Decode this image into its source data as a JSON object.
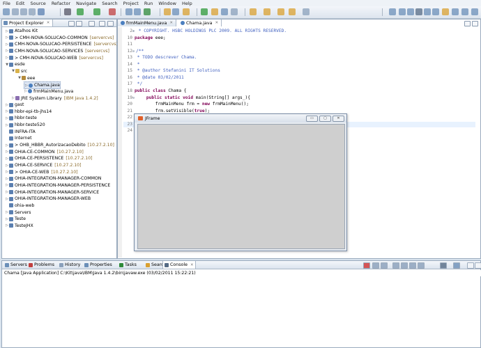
{
  "menu": [
    "File",
    "Edit",
    "Source",
    "Refactor",
    "Navigate",
    "Search",
    "Project",
    "Run",
    "Window",
    "Help"
  ],
  "explorer": {
    "title": "Project Explorer",
    "items": [
      {
        "label": "Atalhos Kit",
        "icon": "project",
        "indent": 0,
        "twisty": "closed"
      },
      {
        "label": "> CMH-NOVA-SOLUCAO-COMMON",
        "deco": "[servercvs]",
        "icon": "project",
        "indent": 0,
        "twisty": "closed"
      },
      {
        "label": "CMH-NOVA-SOLUCAO-PERSISTENCE",
        "deco": "[servercvs]",
        "icon": "project",
        "indent": 0,
        "twisty": "closed"
      },
      {
        "label": "CMH-NOVA-SOLUCAO-SERVICES",
        "deco": "[servercvs]",
        "icon": "project",
        "indent": 0,
        "twisty": "closed"
      },
      {
        "label": "> CMH-NOVA-SOLUCAO-WEB",
        "deco": "[servercvs]",
        "icon": "project",
        "indent": 0,
        "twisty": "closed"
      },
      {
        "label": "esde",
        "icon": "project",
        "indent": 0,
        "twisty": "open"
      },
      {
        "label": "src",
        "icon": "folder",
        "indent": 1,
        "twisty": "open"
      },
      {
        "label": "eee",
        "icon": "package",
        "indent": 2,
        "twisty": "open"
      },
      {
        "label": "Chama.java",
        "icon": "java",
        "indent": 3,
        "twisty": "closed",
        "selected": true
      },
      {
        "label": "frmMainMenu.java",
        "icon": "java",
        "indent": 3,
        "twisty": "closed"
      },
      {
        "label": "JRE System Library",
        "deco": "[IBM Java 1.4.2]",
        "icon": "lib",
        "indent": 1,
        "twisty": "closed"
      },
      {
        "label": "gast",
        "icon": "project",
        "indent": 0,
        "twisty": "closed"
      },
      {
        "label": "hbbr-epi-tb-jhs14",
        "icon": "project",
        "indent": 0,
        "twisty": "closed"
      },
      {
        "label": "hbbr-teste",
        "icon": "project",
        "indent": 0,
        "twisty": "closed"
      },
      {
        "label": "hbbr-teste520",
        "icon": "project",
        "indent": 0,
        "twisty": "closed"
      },
      {
        "label": "INFRA-ITA",
        "icon": "project",
        "indent": 0,
        "twisty": "none"
      },
      {
        "label": "Internet",
        "icon": "project",
        "indent": 0,
        "twisty": "none"
      },
      {
        "label": "> OHB_HBBR_AutorizacaoDebito",
        "deco": "[10.27.2.10]",
        "icon": "project",
        "indent": 0,
        "twisty": "closed"
      },
      {
        "label": "OHIA-CE-COMMON",
        "deco": "[10.27.2.10]",
        "icon": "project",
        "indent": 0,
        "twisty": "closed"
      },
      {
        "label": "OHIA-CE-PERSISTENCE",
        "deco": "[10.27.2.10]",
        "icon": "project",
        "indent": 0,
        "twisty": "closed"
      },
      {
        "label": "OHIA-CE-SERVICE",
        "deco": "[10.27.2.10]",
        "icon": "project",
        "indent": 0,
        "twisty": "closed"
      },
      {
        "label": "> OHIA-CE-WEB",
        "deco": "[10.27.2.10]",
        "icon": "project",
        "indent": 0,
        "twisty": "closed"
      },
      {
        "label": "OHIA-INTEGRATION-MANAGER-COMMON",
        "icon": "project",
        "indent": 0,
        "twisty": "closed"
      },
      {
        "label": "OHIA-INTEGRATION-MANAGER-PERSISTENCE",
        "icon": "project",
        "indent": 0,
        "twisty": "closed"
      },
      {
        "label": "OHIA-INTEGRATION-MANAGER-SERVICE",
        "icon": "project",
        "indent": 0,
        "twisty": "closed"
      },
      {
        "label": "OHIA-INTEGRATION-MANAGER-WEB",
        "icon": "project",
        "indent": 0,
        "twisty": "closed"
      },
      {
        "label": "ohia-web",
        "icon": "project",
        "indent": 0,
        "twisty": "none"
      },
      {
        "label": "Servers",
        "icon": "project",
        "indent": 0,
        "twisty": "closed"
      },
      {
        "label": "Teste",
        "icon": "project",
        "indent": 0,
        "twisty": "closed"
      },
      {
        "label": "TesteJHX",
        "icon": "project",
        "indent": 0,
        "twisty": "closed"
      }
    ]
  },
  "editor": {
    "tabs": [
      {
        "label": "frmMainMenu.java",
        "active": false
      },
      {
        "label": "Chama.java",
        "active": true
      }
    ],
    "lines": [
      {
        "num": "2",
        "fold": "⊕",
        "parts": [
          {
            "t": " * COPYRIGHT. HSBC HOLDINGS PLC 2009. ALL RIGHTS RESERVED.",
            "c": "cm"
          }
        ]
      },
      {
        "num": "10",
        "parts": [
          {
            "t": "package",
            "c": "kw"
          },
          {
            "t": " eee;"
          }
        ]
      },
      {
        "num": "11",
        "parts": []
      },
      {
        "num": "12",
        "fold": "⊖",
        "parts": [
          {
            "t": "/**",
            "c": "cm"
          }
        ]
      },
      {
        "num": "13",
        "parts": [
          {
            "t": " * TODO descrever Chama.",
            "c": "cm"
          }
        ]
      },
      {
        "num": "14",
        "parts": [
          {
            "t": " *",
            "c": "cm"
          }
        ]
      },
      {
        "num": "15",
        "parts": [
          {
            "t": " * @author Stefanini IT Solutions",
            "c": "cm"
          }
        ]
      },
      {
        "num": "16",
        "parts": [
          {
            "t": " * @date 03/02/2011",
            "c": "cm"
          }
        ]
      },
      {
        "num": "17",
        "parts": [
          {
            "t": " */",
            "c": "cm"
          }
        ]
      },
      {
        "num": "18",
        "parts": [
          {
            "t": "public class",
            "c": "kw"
          },
          {
            "t": " Chama {"
          }
        ]
      },
      {
        "num": "19",
        "fold": "⊖",
        "parts": [
          {
            "t": "    "
          },
          {
            "t": "public static void",
            "c": "kw"
          },
          {
            "t": " main(String[] args_){"
          }
        ]
      },
      {
        "num": "20",
        "parts": [
          {
            "t": "        frmMainMenu frm = "
          },
          {
            "t": "new",
            "c": "kw"
          },
          {
            "t": " frmMainMenu();"
          }
        ]
      },
      {
        "num": "21",
        "parts": [
          {
            "t": "        frm.setVisible("
          },
          {
            "t": "true",
            "c": "kw"
          },
          {
            "t": ");"
          }
        ]
      },
      {
        "num": "22",
        "parts": [
          {
            "t": "    }"
          }
        ]
      },
      {
        "num": "23",
        "current": true,
        "parts": [
          {
            "t": "}"
          }
        ]
      },
      {
        "num": "24",
        "parts": []
      }
    ]
  },
  "jframe": {
    "title": "JFrame",
    "buttons": [
      "▭",
      "▢",
      "✕"
    ]
  },
  "console": {
    "tabs": [
      "Servers",
      "Problems",
      "History",
      "Properties",
      "Tasks",
      "Search",
      "Console"
    ],
    "active": "Console",
    "header": "Chama [Java Application] C:\\Kit\\java\\IBM\\Java 1.4.2\\bin\\javaw.exe (03/02/2011 15:22:21)"
  }
}
